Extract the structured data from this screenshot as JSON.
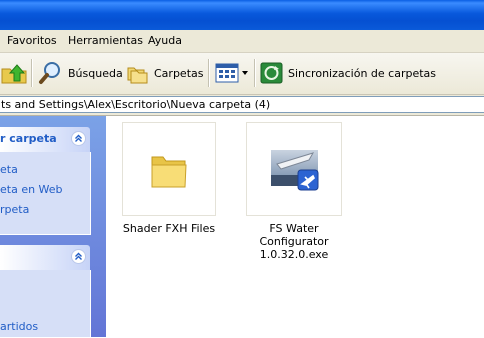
{
  "menu": {
    "items": [
      "Favoritos",
      "Herramientas",
      "Ayuda"
    ]
  },
  "toolbar": {
    "search_label": "Búsqueda",
    "folders_label": "Carpetas",
    "sync_label": "Sincronización de carpetas"
  },
  "address": {
    "path": "ts and Settings\\Alex\\Escritorio\\Nueva carpeta (4)"
  },
  "taskpane": {
    "panel1": {
      "title": "r carpeta",
      "links": [
        "eta",
        "eta en Web",
        "rpeta"
      ]
    },
    "panel2": {
      "title": "",
      "links": [
        "artidos"
      ]
    }
  },
  "files": [
    {
      "name": "Shader FXH Files",
      "icon": "folder-icon"
    },
    {
      "name": "FS Water Configurator 1.0.32.0.exe",
      "icon": "exe-app-icon",
      "line1": "FS Water Configurator",
      "line2": "1.0.32.0.exe"
    }
  ],
  "colors": {
    "titlebar": "#0a5fe3",
    "taskpane_bg": "#6f8fe0",
    "link": "#215dc6",
    "chrome": "#ece9d8"
  }
}
